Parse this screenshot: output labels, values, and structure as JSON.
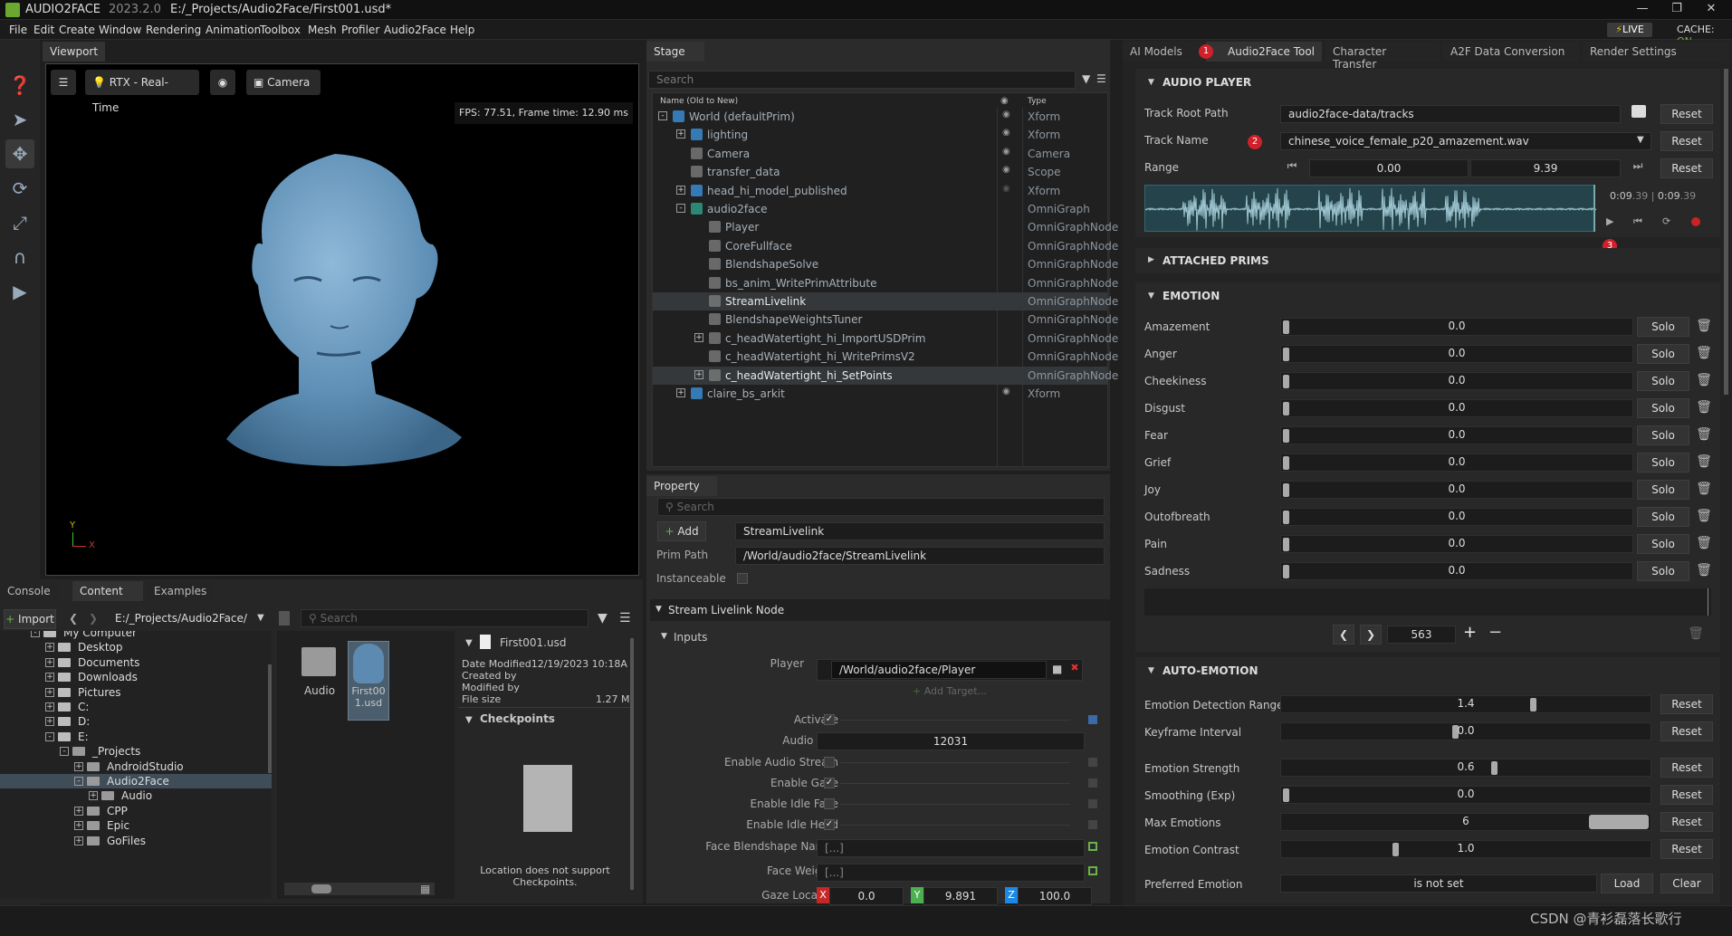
{
  "window": {
    "app_name": "AUDIO2FACE",
    "version": "2023.2.0",
    "path": "E:/_Projects/Audio2Face/First001.usd*",
    "live_label": "LIVE",
    "cache_label": "CACHE:",
    "cache_status": "ON"
  },
  "menu": [
    "File",
    "Edit",
    "Create",
    "Window",
    "Rendering",
    "Animation",
    "Toolbox",
    "Mesh",
    "Profiler",
    "Audio2Face",
    "Help"
  ],
  "viewport": {
    "tab": "Viewport",
    "render_mode": "RTX - Real-Time",
    "camera_label": "Camera",
    "fps_text": "FPS: 77.51, Frame time: 12.90 ms",
    "axis_y": "Y",
    "axis_x": "X"
  },
  "bottom_left": {
    "tabs": [
      "Console",
      "Content",
      "Examples"
    ],
    "import_label": "Import",
    "path": "E:/_Projects/Audio2Face/",
    "search_placeholder": "Search",
    "tree": [
      {
        "label": "My Computer",
        "indent": 1
      },
      {
        "label": "Desktop",
        "indent": 2
      },
      {
        "label": "Documents",
        "indent": 2
      },
      {
        "label": "Downloads",
        "indent": 2
      },
      {
        "label": "Pictures",
        "indent": 2
      },
      {
        "label": "C:",
        "indent": 2
      },
      {
        "label": "D:",
        "indent": 2
      },
      {
        "label": "E:",
        "indent": 2
      },
      {
        "label": "_Projects",
        "indent": 3
      },
      {
        "label": "AndroidStudio",
        "indent": 4
      },
      {
        "label": "Audio2Face",
        "indent": 4
      },
      {
        "label": "Audio",
        "indent": 5
      },
      {
        "label": "CPP",
        "indent": 4
      },
      {
        "label": "Epic",
        "indent": 4
      },
      {
        "label": "GoFiles",
        "indent": 4
      }
    ],
    "files": [
      {
        "label": "Audio"
      },
      {
        "label": "First001.usd"
      }
    ],
    "detail": {
      "file_name": "First001.usd",
      "date_modified_label": "Date Modified",
      "date_modified": "12/19/2023 10:18A",
      "created_by_label": "Created by",
      "modified_by_label": "Modified by",
      "file_size_label": "File size",
      "file_size": "1.27 M",
      "checkpoints_label": "Checkpoints",
      "checkpoints_note": "Location does not support Checkpoints."
    }
  },
  "stage": {
    "tab": "Stage",
    "search_placeholder": "Search",
    "col_name": "Name (Old to New)",
    "col_type": "Type",
    "rows": [
      {
        "name": "World (defaultPrim)",
        "type": "Xform",
        "indent": 0,
        "expand": "-"
      },
      {
        "name": "lighting",
        "type": "Xform",
        "indent": 1,
        "expand": "+"
      },
      {
        "name": "Camera",
        "type": "Camera",
        "indent": 1,
        "expand": ""
      },
      {
        "name": "transfer_data",
        "type": "Scope",
        "indent": 1,
        "expand": ""
      },
      {
        "name": "head_hi_model_published",
        "type": "Xform",
        "indent": 1,
        "expand": "+"
      },
      {
        "name": "audio2face",
        "type": "OmniGraph",
        "indent": 1,
        "expand": "-"
      },
      {
        "name": "Player",
        "type": "OmniGraphNode",
        "indent": 2,
        "expand": ""
      },
      {
        "name": "CoreFullface",
        "type": "OmniGraphNode",
        "indent": 2,
        "expand": ""
      },
      {
        "name": "BlendshapeSolve",
        "type": "OmniGraphNode",
        "indent": 2,
        "expand": ""
      },
      {
        "name": "bs_anim_WritePrimAttribute",
        "type": "OmniGraphNode",
        "indent": 2,
        "expand": ""
      },
      {
        "name": "StreamLivelink",
        "type": "OmniGraphNode",
        "indent": 2,
        "expand": ""
      },
      {
        "name": "BlendshapeWeightsTuner",
        "type": "OmniGraphNode",
        "indent": 2,
        "expand": ""
      },
      {
        "name": "c_headWatertight_hi_ImportUSDPrim",
        "type": "OmniGraphNode",
        "indent": 2,
        "expand": "+"
      },
      {
        "name": "c_headWatertight_hi_WritePrimsV2",
        "type": "OmniGraphNode",
        "indent": 2,
        "expand": ""
      },
      {
        "name": "c_headWatertight_hi_SetPoints",
        "type": "OmniGraphNode",
        "indent": 2,
        "expand": "+"
      },
      {
        "name": "claire_bs_arkit",
        "type": "Xform",
        "indent": 1,
        "expand": "+"
      }
    ]
  },
  "property": {
    "tab": "Property",
    "search_placeholder": "Search",
    "add_label": "Add",
    "name_value": "StreamLivelink",
    "prim_path_label": "Prim Path",
    "prim_path": "/World/audio2face/StreamLivelink",
    "instanceable_label": "Instanceable",
    "section": "Stream Livelink Node",
    "inputs_label": "Inputs",
    "player_label": "Player",
    "player_value": "/World/audio2face/Player",
    "add_target_label": "Add Target...",
    "activate_label": "Activate",
    "audio_port_label": "Audio Port",
    "audio_port": "12031",
    "enable_audio_stream_label": "Enable Audio Stream",
    "enable_gaze_label": "Enable Gaze",
    "enable_idle_face_label": "Enable Idle Face",
    "enable_idle_head_label": "Enable Idle Head",
    "face_bs_names_label": "Face Blendshape Names",
    "face_bs_names": "[...]",
    "face_weights_label": "Face Weights",
    "face_weights": "[...]",
    "gaze_location_label": "Gaze Location",
    "gaze_x_label": "X",
    "gaze_y_label": "Y",
    "gaze_z_label": "Z",
    "gaze_x": "0.0",
    "gaze_y": "9.891",
    "gaze_z": "100.0"
  },
  "right": {
    "tabs": [
      "AI Models",
      "Audio2Face Tool",
      "Character Transfer",
      "A2F Data Conversion",
      "Render Settings"
    ],
    "audio_player_title": "AUDIO PLAYER",
    "track_root_label": "Track Root Path",
    "track_root": "audio2face-data/tracks",
    "track_name_label": "Track Name",
    "track_name": "chinese_voice_female_p20_amazement.wav",
    "range_label": "Range",
    "range_start": "0.00",
    "range_end": "9.39",
    "reset_label": "Reset",
    "time_current": "0:09",
    "time_current_frac": ".39",
    "time_sep": "|",
    "time_total": "0:09",
    "time_total_frac": ".39",
    "attached_prims_title": "ATTACHED PRIMS",
    "emotion_title": "EMOTION",
    "solo_label": "Solo",
    "emotions": [
      {
        "name": "Amazement",
        "value": "0.0"
      },
      {
        "name": "Anger",
        "value": "0.0"
      },
      {
        "name": "Cheekiness",
        "value": "0.0"
      },
      {
        "name": "Disgust",
        "value": "0.0"
      },
      {
        "name": "Fear",
        "value": "0.0"
      },
      {
        "name": "Grief",
        "value": "0.0"
      },
      {
        "name": "Joy",
        "value": "0.0"
      },
      {
        "name": "Outofbreath",
        "value": "0.0"
      },
      {
        "name": "Pain",
        "value": "0.0"
      },
      {
        "name": "Sadness",
        "value": "0.0"
      }
    ],
    "frame_value": "563",
    "auto_emotion_title": "AUTO-EMOTION",
    "auto": [
      {
        "label": "Emotion Detection Range",
        "value": "1.4",
        "pos": 0.7
      },
      {
        "label": "Keyframe Interval",
        "value": "0.0",
        "pos": 0.48
      },
      {
        "label": "Emotion Strength",
        "value": "0.6",
        "pos": 0.59
      },
      {
        "label": "Smoothing (Exp)",
        "value": "0.0",
        "pos": 0.0
      },
      {
        "label": "Max Emotions",
        "value": "6",
        "pos": 1.0
      },
      {
        "label": "Emotion Contrast",
        "value": "1.0",
        "pos": 0.31
      }
    ],
    "preferred_emotion_label": "Preferred Emotion",
    "preferred_emotion": "is not set",
    "load_label": "Load",
    "clear_label": "Clear",
    "badges": [
      "1",
      "2",
      "3"
    ]
  },
  "watermark": "CSDN @青衫磊落长歌行"
}
